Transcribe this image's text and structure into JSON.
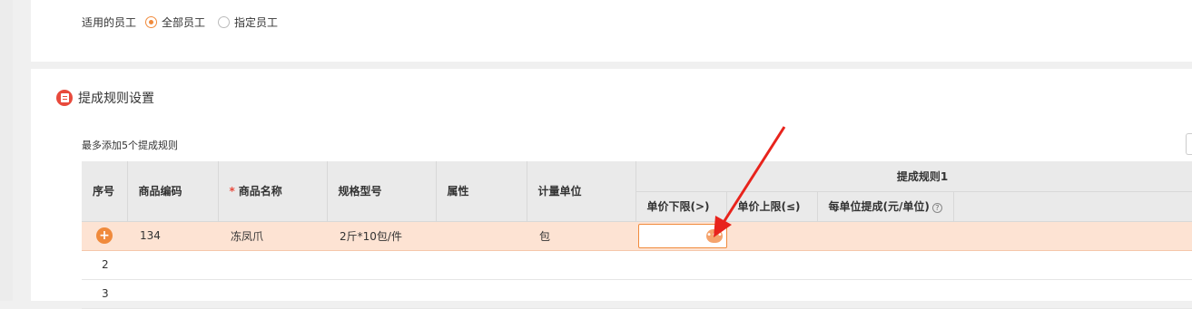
{
  "employees": {
    "label": "适用的员工",
    "options": [
      {
        "label": "全部员工",
        "checked": true
      },
      {
        "label": "指定员工",
        "checked": false
      }
    ]
  },
  "section": {
    "title": "提成规则设置",
    "icon": "list-icon",
    "hint": "最多添加5个提成规则"
  },
  "table": {
    "headers": {
      "index": "序号",
      "code": "商品编码",
      "name": "商品名称",
      "spec": "规格型号",
      "attr": "属性",
      "unit": "计量单位",
      "rule_group": "提成规则1",
      "min_price": "单价下限(>)",
      "max_price": "单价上限(≤)",
      "per_unit": "每单位提成(元/单位)",
      "help_icon": "?"
    },
    "rows": [
      {
        "index": "",
        "code": "134",
        "name": "冻凤爪",
        "spec": "2斤*10包/件",
        "attr": "",
        "unit": "包"
      },
      {
        "index": "2",
        "code": "",
        "name": "",
        "spec": "",
        "attr": "",
        "unit": ""
      },
      {
        "index": "3",
        "code": "",
        "name": "",
        "spec": "",
        "attr": "",
        "unit": ""
      }
    ],
    "add_icon": "+",
    "more_icon": "•••"
  },
  "colors": {
    "accent": "#f08a3c",
    "active_row": "#fde3d3",
    "annotation_arrow": "#e8231c"
  }
}
